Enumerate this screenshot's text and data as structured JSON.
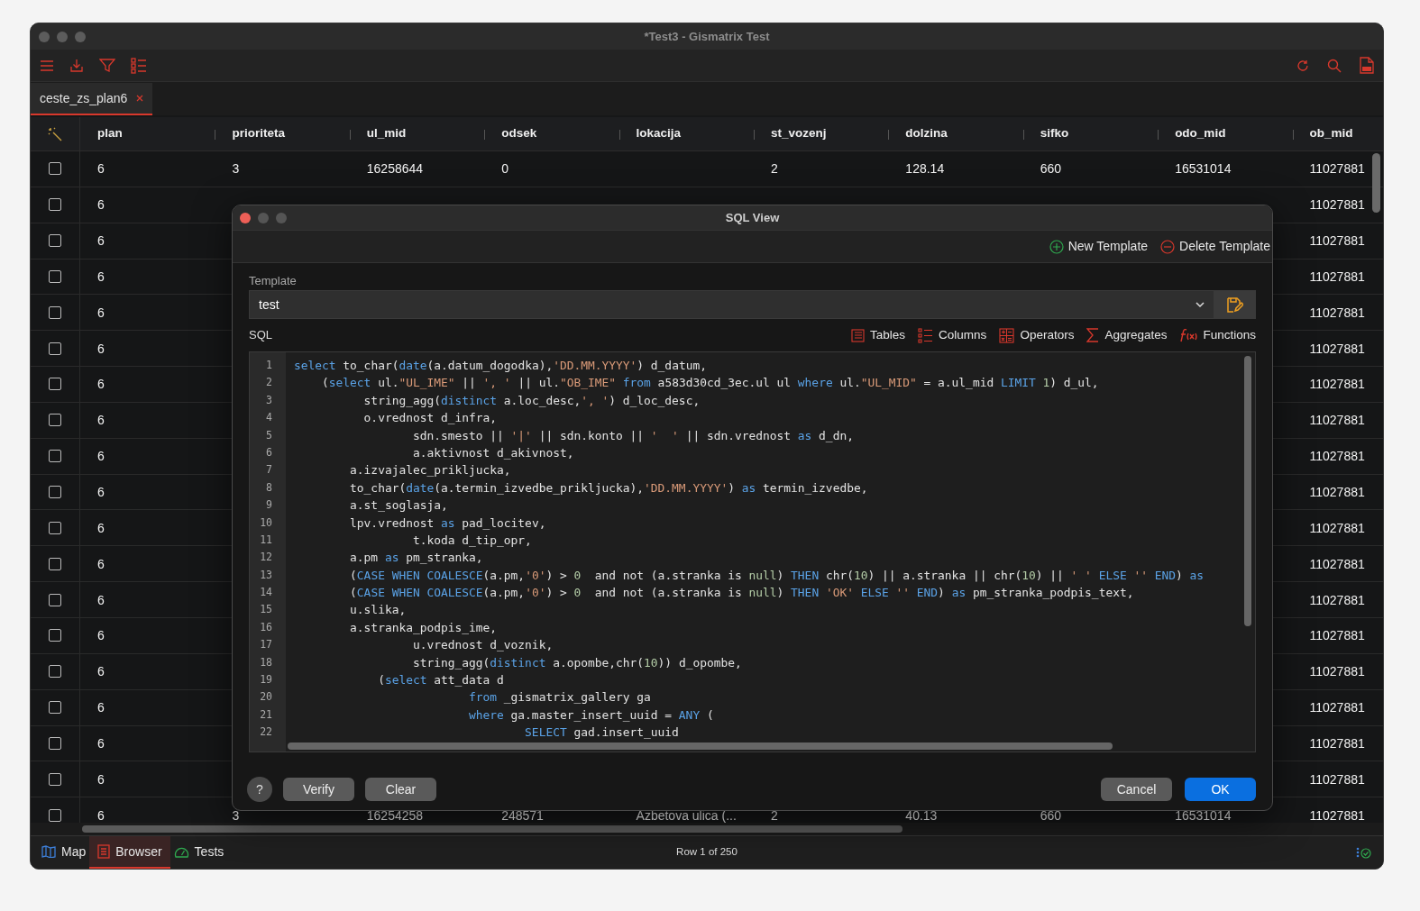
{
  "window": {
    "title": "*Test3 - Gismatrix Test"
  },
  "tabs": [
    {
      "label": "ceste_zs_plan6",
      "selected": true
    }
  ],
  "table": {
    "columns": [
      "plan",
      "prioriteta",
      "ul_mid",
      "odsek",
      "lokacija",
      "st_vozenj",
      "dolzina",
      "sifko",
      "odo_mid",
      "ob_mid"
    ],
    "rows": [
      {
        "checked": false,
        "cells": [
          "6",
          "3",
          "16258644",
          "0",
          null,
          "2",
          "128.14",
          "660",
          "16531014",
          "11027881"
        ]
      },
      {
        "checked": false,
        "cells": [
          "6",
          null,
          null,
          null,
          null,
          null,
          null,
          null,
          null,
          "11027881"
        ]
      },
      {
        "checked": false,
        "cells": [
          "6",
          null,
          null,
          null,
          null,
          null,
          null,
          null,
          null,
          "11027881"
        ]
      },
      {
        "checked": false,
        "cells": [
          "6",
          null,
          null,
          null,
          null,
          null,
          null,
          null,
          null,
          "11027881"
        ]
      },
      {
        "checked": false,
        "cells": [
          "6",
          null,
          null,
          null,
          null,
          null,
          null,
          null,
          null,
          "11027881"
        ]
      },
      {
        "checked": false,
        "cells": [
          "6",
          null,
          null,
          null,
          null,
          null,
          null,
          null,
          null,
          "11027881"
        ]
      },
      {
        "checked": false,
        "cells": [
          "6",
          null,
          null,
          null,
          null,
          null,
          null,
          null,
          null,
          "11027881"
        ]
      },
      {
        "checked": false,
        "cells": [
          "6",
          null,
          null,
          null,
          null,
          null,
          null,
          null,
          null,
          "11027881"
        ]
      },
      {
        "checked": false,
        "cells": [
          "6",
          null,
          null,
          null,
          null,
          null,
          null,
          null,
          null,
          "11027881"
        ]
      },
      {
        "checked": false,
        "cells": [
          "6",
          null,
          null,
          null,
          null,
          null,
          null,
          null,
          null,
          "11027881"
        ]
      },
      {
        "checked": false,
        "cells": [
          "6",
          null,
          null,
          null,
          null,
          null,
          null,
          null,
          null,
          "11027881"
        ]
      },
      {
        "checked": false,
        "cells": [
          "6",
          null,
          null,
          null,
          null,
          null,
          null,
          null,
          null,
          "11027881"
        ]
      },
      {
        "checked": false,
        "cells": [
          "6",
          null,
          null,
          null,
          null,
          null,
          null,
          null,
          null,
          "11027881"
        ]
      },
      {
        "checked": false,
        "cells": [
          "6",
          null,
          null,
          null,
          null,
          null,
          null,
          null,
          null,
          "11027881"
        ]
      },
      {
        "checked": false,
        "cells": [
          "6",
          null,
          null,
          null,
          null,
          null,
          null,
          null,
          null,
          "11027881"
        ]
      },
      {
        "checked": false,
        "cells": [
          "6",
          null,
          null,
          null,
          null,
          null,
          null,
          null,
          null,
          "11027881"
        ]
      },
      {
        "checked": false,
        "cells": [
          "6",
          null,
          null,
          null,
          null,
          null,
          null,
          null,
          null,
          "11027881"
        ]
      },
      {
        "checked": false,
        "cells": [
          "6",
          null,
          null,
          null,
          null,
          null,
          null,
          null,
          null,
          "11027881"
        ]
      },
      {
        "checked": false,
        "cells": [
          "6",
          "3",
          "16254258",
          "248571",
          "Azbetova ulica (...",
          "2",
          "40.13",
          "660",
          "16531014",
          "11027881"
        ]
      }
    ]
  },
  "status_bar": {
    "tabs": [
      {
        "kind": "map",
        "label": "Map",
        "selected": false
      },
      {
        "kind": "browser",
        "label": "Browser",
        "selected": true
      },
      {
        "kind": "tests",
        "label": "Tests",
        "selected": false
      }
    ],
    "row_info": "Row 1 of 250"
  },
  "dialog": {
    "title": "SQL View",
    "actions": [
      {
        "kind": "add",
        "label": "New Template"
      },
      {
        "kind": "remove",
        "label": "Delete Template"
      }
    ],
    "template_label": "Template",
    "template_value": "test",
    "sql_label": "SQL",
    "inserters": [
      {
        "kind": "tables",
        "label": "Tables"
      },
      {
        "kind": "columns",
        "label": "Columns"
      },
      {
        "kind": "operators",
        "label": "Operators"
      },
      {
        "kind": "aggregates",
        "label": "Aggregates"
      },
      {
        "kind": "functions",
        "label": "Functions"
      }
    ],
    "code_lines": [
      {
        "number": "1",
        "tokens": [
          {
            "kind": "keyword",
            "text": "select"
          },
          {
            "kind": "plain",
            "text": " to_char("
          },
          {
            "kind": "keyword",
            "text": "date"
          },
          {
            "kind": "plain",
            "text": "(a.datum_dogodka),"
          },
          {
            "kind": "string",
            "text": "'DD.MM.YYYY'"
          },
          {
            "kind": "plain",
            "text": ") d_datum,"
          }
        ]
      },
      {
        "number": "2",
        "tokens": [
          {
            "kind": "plain",
            "text": "    ("
          },
          {
            "kind": "keyword",
            "text": "select"
          },
          {
            "kind": "plain",
            "text": " ul."
          },
          {
            "kind": "string",
            "text": "\"UL_IME\""
          },
          {
            "kind": "plain",
            "text": " || "
          },
          {
            "kind": "string",
            "text": "', '"
          },
          {
            "kind": "plain",
            "text": " || ul."
          },
          {
            "kind": "string",
            "text": "\"OB_IME\""
          },
          {
            "kind": "keyword",
            "text": " from"
          },
          {
            "kind": "plain",
            "text": " a583d30cd_3ec.ul ul "
          },
          {
            "kind": "keyword",
            "text": "where"
          },
          {
            "kind": "plain",
            "text": " ul."
          },
          {
            "kind": "string",
            "text": "\"UL_MID\""
          },
          {
            "kind": "plain",
            "text": " = a.ul_mid "
          },
          {
            "kind": "keyword",
            "text": "LIMIT"
          },
          {
            "kind": "number",
            "text": " 1"
          },
          {
            "kind": "plain",
            "text": ") d_ul,"
          }
        ]
      },
      {
        "number": "3",
        "tokens": [
          {
            "kind": "plain",
            "text": "          string_agg("
          },
          {
            "kind": "keyword",
            "text": "distinct"
          },
          {
            "kind": "plain",
            "text": " a.loc_desc,"
          },
          {
            "kind": "string",
            "text": "', '"
          },
          {
            "kind": "plain",
            "text": ") d_loc_desc,"
          }
        ]
      },
      {
        "number": "4",
        "tokens": [
          {
            "kind": "plain",
            "text": "          o.vrednost d_infra,"
          }
        ]
      },
      {
        "number": "5",
        "tokens": [
          {
            "kind": "plain",
            "text": "                 sdn.smesto || "
          },
          {
            "kind": "string",
            "text": "'|'"
          },
          {
            "kind": "plain",
            "text": " || sdn.konto || "
          },
          {
            "kind": "string",
            "text": "'  '"
          },
          {
            "kind": "plain",
            "text": " || sdn.vrednost "
          },
          {
            "kind": "keyword",
            "text": "as"
          },
          {
            "kind": "plain",
            "text": " d_dn,"
          }
        ]
      },
      {
        "number": "6",
        "tokens": [
          {
            "kind": "plain",
            "text": "                 a.aktivnost d_akivnost,"
          }
        ]
      },
      {
        "number": "7",
        "tokens": [
          {
            "kind": "plain",
            "text": "        a.izvajalec_prikljucka,"
          }
        ]
      },
      {
        "number": "8",
        "tokens": [
          {
            "kind": "plain",
            "text": "        to_char("
          },
          {
            "kind": "keyword",
            "text": "date"
          },
          {
            "kind": "plain",
            "text": "(a.termin_izvedbe_prikljucka),"
          },
          {
            "kind": "string",
            "text": "'DD.MM.YYYY'"
          },
          {
            "kind": "plain",
            "text": ") "
          },
          {
            "kind": "keyword",
            "text": "as"
          },
          {
            "kind": "plain",
            "text": " termin_izvedbe,"
          }
        ]
      },
      {
        "number": "9",
        "tokens": [
          {
            "kind": "plain",
            "text": "        a.st_soglasja,"
          }
        ]
      },
      {
        "number": "10",
        "tokens": [
          {
            "kind": "plain",
            "text": "        lpv.vrednost "
          },
          {
            "kind": "keyword",
            "text": "as"
          },
          {
            "kind": "plain",
            "text": " pad_locitev,"
          }
        ]
      },
      {
        "number": "11",
        "tokens": [
          {
            "kind": "plain",
            "text": "                 t.koda d_tip_opr,"
          }
        ]
      },
      {
        "number": "12",
        "tokens": [
          {
            "kind": "plain",
            "text": "        a.pm "
          },
          {
            "kind": "keyword",
            "text": "as"
          },
          {
            "kind": "plain",
            "text": " pm_stranka,"
          }
        ]
      },
      {
        "number": "13",
        "tokens": [
          {
            "kind": "plain",
            "text": "        ("
          },
          {
            "kind": "keyword",
            "text": "CASE WHEN COALESCE"
          },
          {
            "kind": "plain",
            "text": "(a.pm,"
          },
          {
            "kind": "string",
            "text": "'0'"
          },
          {
            "kind": "plain",
            "text": ") > "
          },
          {
            "kind": "number",
            "text": "0"
          },
          {
            "kind": "plain",
            "text": "  and not (a.stranka is "
          },
          {
            "kind": "number",
            "text": "null"
          },
          {
            "kind": "plain",
            "text": ") "
          },
          {
            "kind": "keyword",
            "text": "THEN"
          },
          {
            "kind": "plain",
            "text": " chr("
          },
          {
            "kind": "number",
            "text": "10"
          },
          {
            "kind": "plain",
            "text": ") || a.stranka || chr("
          },
          {
            "kind": "number",
            "text": "10"
          },
          {
            "kind": "plain",
            "text": ") || "
          },
          {
            "kind": "string",
            "text": "' '"
          },
          {
            "kind": "keyword",
            "text": " ELSE"
          },
          {
            "kind": "string",
            "text": " ''"
          },
          {
            "kind": "keyword",
            "text": " END"
          },
          {
            "kind": "plain",
            "text": ") "
          },
          {
            "kind": "keyword",
            "text": "as"
          }
        ]
      },
      {
        "number": "14",
        "tokens": [
          {
            "kind": "plain",
            "text": "        ("
          },
          {
            "kind": "keyword",
            "text": "CASE WHEN COALESCE"
          },
          {
            "kind": "plain",
            "text": "(a.pm,"
          },
          {
            "kind": "string",
            "text": "'0'"
          },
          {
            "kind": "plain",
            "text": ") > "
          },
          {
            "kind": "number",
            "text": "0"
          },
          {
            "kind": "plain",
            "text": "  and not (a.stranka is "
          },
          {
            "kind": "number",
            "text": "null"
          },
          {
            "kind": "plain",
            "text": ") "
          },
          {
            "kind": "keyword",
            "text": "THEN"
          },
          {
            "kind": "string",
            "text": " 'OK'"
          },
          {
            "kind": "keyword",
            "text": " ELSE"
          },
          {
            "kind": "string",
            "text": " ''"
          },
          {
            "kind": "keyword",
            "text": " END"
          },
          {
            "kind": "plain",
            "text": ") "
          },
          {
            "kind": "keyword",
            "text": "as"
          },
          {
            "kind": "plain",
            "text": " pm_stranka_podpis_text,"
          }
        ]
      },
      {
        "number": "15",
        "tokens": [
          {
            "kind": "plain",
            "text": "        u.slika,"
          }
        ]
      },
      {
        "number": "16",
        "tokens": [
          {
            "kind": "plain",
            "text": "        a.stranka_podpis_ime,"
          }
        ]
      },
      {
        "number": "17",
        "tokens": [
          {
            "kind": "plain",
            "text": "                 u.vrednost d_voznik,"
          }
        ]
      },
      {
        "number": "18",
        "tokens": [
          {
            "kind": "plain",
            "text": "                 string_agg("
          },
          {
            "kind": "keyword",
            "text": "distinct"
          },
          {
            "kind": "plain",
            "text": " a.opombe,chr("
          },
          {
            "kind": "number",
            "text": "10"
          },
          {
            "kind": "plain",
            "text": ")) d_opombe,"
          }
        ]
      },
      {
        "number": "19",
        "tokens": [
          {
            "kind": "plain",
            "text": "            ("
          },
          {
            "kind": "keyword",
            "text": "select"
          },
          {
            "kind": "plain",
            "text": " att_data d"
          }
        ]
      },
      {
        "number": "20",
        "tokens": [
          {
            "kind": "keyword",
            "text": "                         from"
          },
          {
            "kind": "plain",
            "text": " _gismatrix_gallery ga"
          }
        ]
      },
      {
        "number": "21",
        "tokens": [
          {
            "kind": "keyword",
            "text": "                         where"
          },
          {
            "kind": "plain",
            "text": " ga.master_insert_uuid = "
          },
          {
            "kind": "keyword",
            "text": "ANY"
          },
          {
            "kind": "plain",
            "text": " ("
          }
        ]
      },
      {
        "number": "22",
        "tokens": [
          {
            "kind": "keyword",
            "text": "                                 SELECT"
          },
          {
            "kind": "plain",
            "text": " gad.insert_uuid"
          }
        ]
      }
    ],
    "left_buttons": [
      {
        "kind": "help",
        "label": "?"
      },
      {
        "kind": "secondary",
        "label": "Verify"
      },
      {
        "kind": "secondary",
        "label": "Clear"
      }
    ],
    "right_buttons": [
      {
        "kind": "secondary",
        "label": "Cancel"
      },
      {
        "kind": "primary",
        "label": "OK"
      }
    ]
  }
}
